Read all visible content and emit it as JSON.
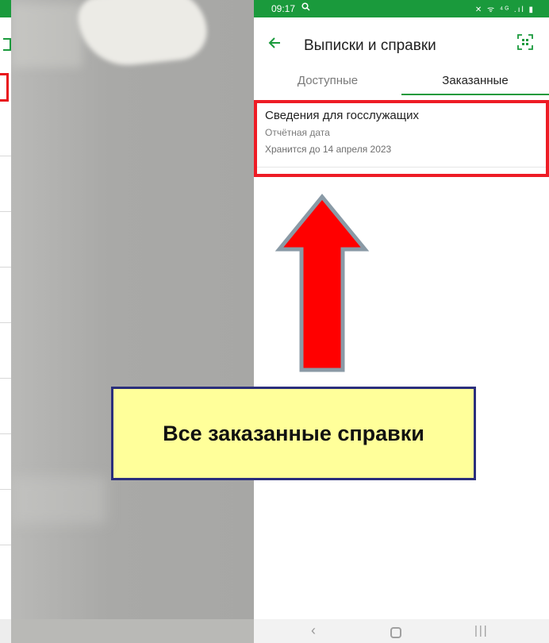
{
  "status_bar": {
    "time": "09:17",
    "icons_text": "✕ ᯤ ⁴ᴳ .ıl ▮"
  },
  "header": {
    "title": "Выписки и справки",
    "back_icon": "arrow-left-icon",
    "scan_icon": "qr-scan-icon"
  },
  "tabs": [
    {
      "label": "Доступные",
      "active": false
    },
    {
      "label": "Заказанные",
      "active": true
    }
  ],
  "document": {
    "title": "Сведения для госслужащих",
    "subtitle": "Отчётная дата",
    "stored_until": "Хранится до 14 апреля 2023"
  },
  "nav": {
    "back": "‹",
    "recent": "|||"
  },
  "callout": {
    "text": "Все заказанные справки"
  },
  "colors": {
    "brand_green": "#1a9a3c",
    "highlight_red": "#ee1c25",
    "callout_bg": "#ffff9a",
    "callout_border": "#2b2f7c",
    "arrow_fill": "#ff0000",
    "arrow_border": "#8a9aa6"
  }
}
